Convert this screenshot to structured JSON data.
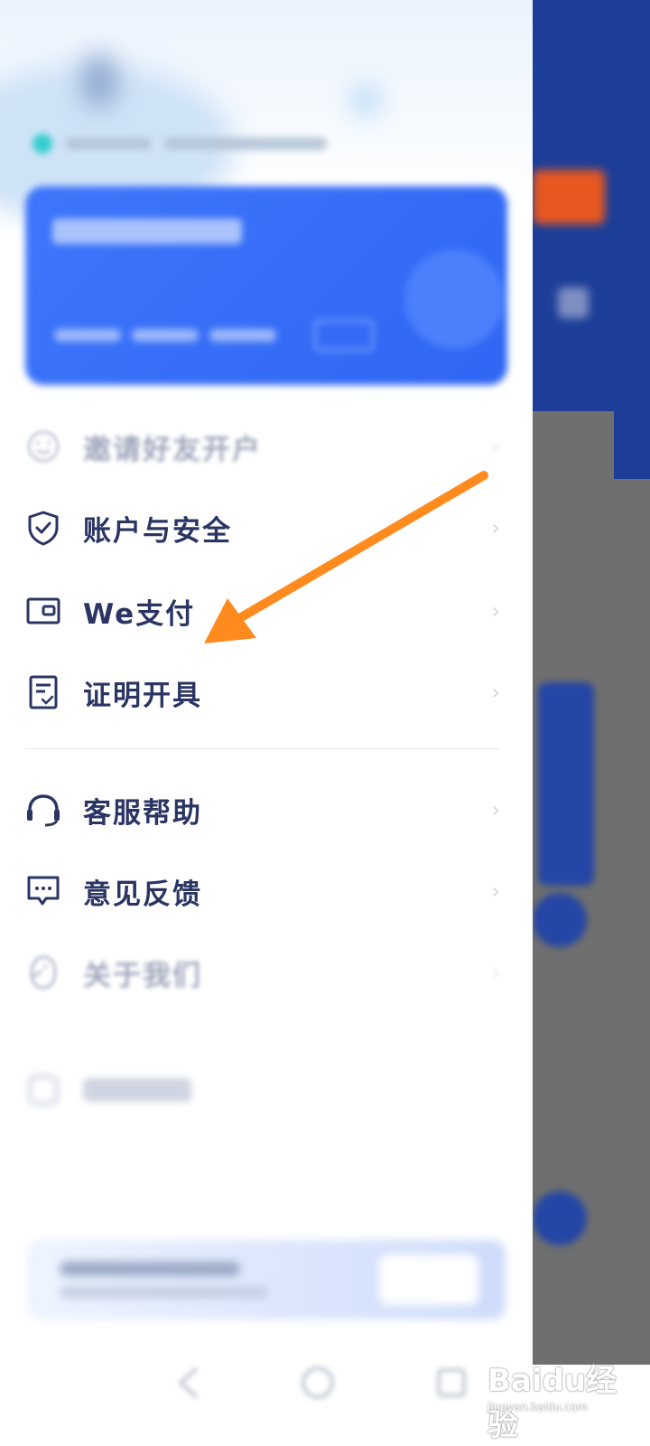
{
  "menu": {
    "items_top": [
      {
        "label": "邀请好友开户",
        "icon": "smile-icon"
      },
      {
        "label": "账户与安全",
        "icon": "shield-icon"
      },
      {
        "label": "We支付",
        "icon": "wallet-icon"
      },
      {
        "label": "证明开具",
        "icon": "certificate-icon"
      }
    ],
    "items_bottom": [
      {
        "label": "客服帮助",
        "icon": "headset-icon"
      },
      {
        "label": "意见反馈",
        "icon": "feedback-icon"
      },
      {
        "label": "关于我们",
        "icon": "penguin-icon"
      }
    ]
  },
  "watermark": {
    "logo": "Baidu经验",
    "url": "jingyan.baidu.com"
  },
  "colors": {
    "accent": "#3e76fb",
    "arrow": "#ff8a1e",
    "menu_text": "#2b3563"
  }
}
